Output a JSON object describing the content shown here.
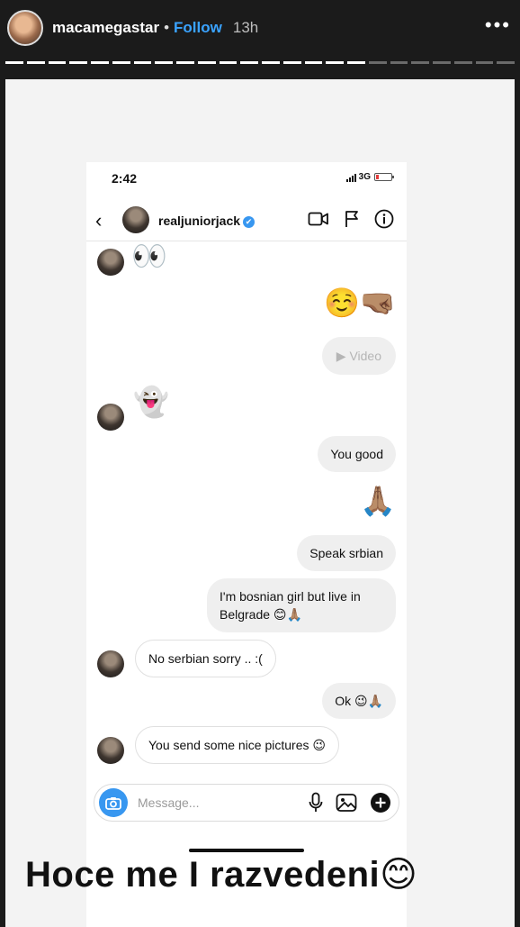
{
  "story": {
    "username": "macamegastar",
    "separator": "•",
    "follow_label": "Follow",
    "time": "13h",
    "more_icon": "more-horizontal-icon",
    "segments_total": 24,
    "segments_done": 17
  },
  "phone": {
    "status_time": "2:42",
    "network": "3G",
    "header": {
      "username": "realjuniorjack",
      "verified": "✔"
    },
    "messages": [
      {
        "from": "them",
        "kind": "emoji",
        "text": "👀"
      },
      {
        "from": "me",
        "kind": "emoji",
        "text": "☺️🤜🏽"
      },
      {
        "from": "me",
        "kind": "video",
        "text": "▶ Video"
      },
      {
        "from": "them",
        "kind": "emoji",
        "text": "👻"
      },
      {
        "from": "me",
        "kind": "text",
        "text": "You good"
      },
      {
        "from": "me",
        "kind": "emoji",
        "text": "🙏🏽"
      },
      {
        "from": "me",
        "kind": "text",
        "text": "Speak srbian"
      },
      {
        "from": "me",
        "kind": "text",
        "text": "I'm bosnian girl but live in",
        "text2": "Belgrade 😊🙏🏽"
      },
      {
        "from": "them",
        "kind": "text",
        "text": "No serbian sorry .. :("
      },
      {
        "from": "me",
        "kind": "text",
        "text": "Ok 😉🙏🏽"
      },
      {
        "from": "them",
        "kind": "text",
        "text": "You send some nice pictures 😉"
      }
    ],
    "composer_placeholder": "Message..."
  },
  "caption": "Hoce me I razvedeni😊"
}
